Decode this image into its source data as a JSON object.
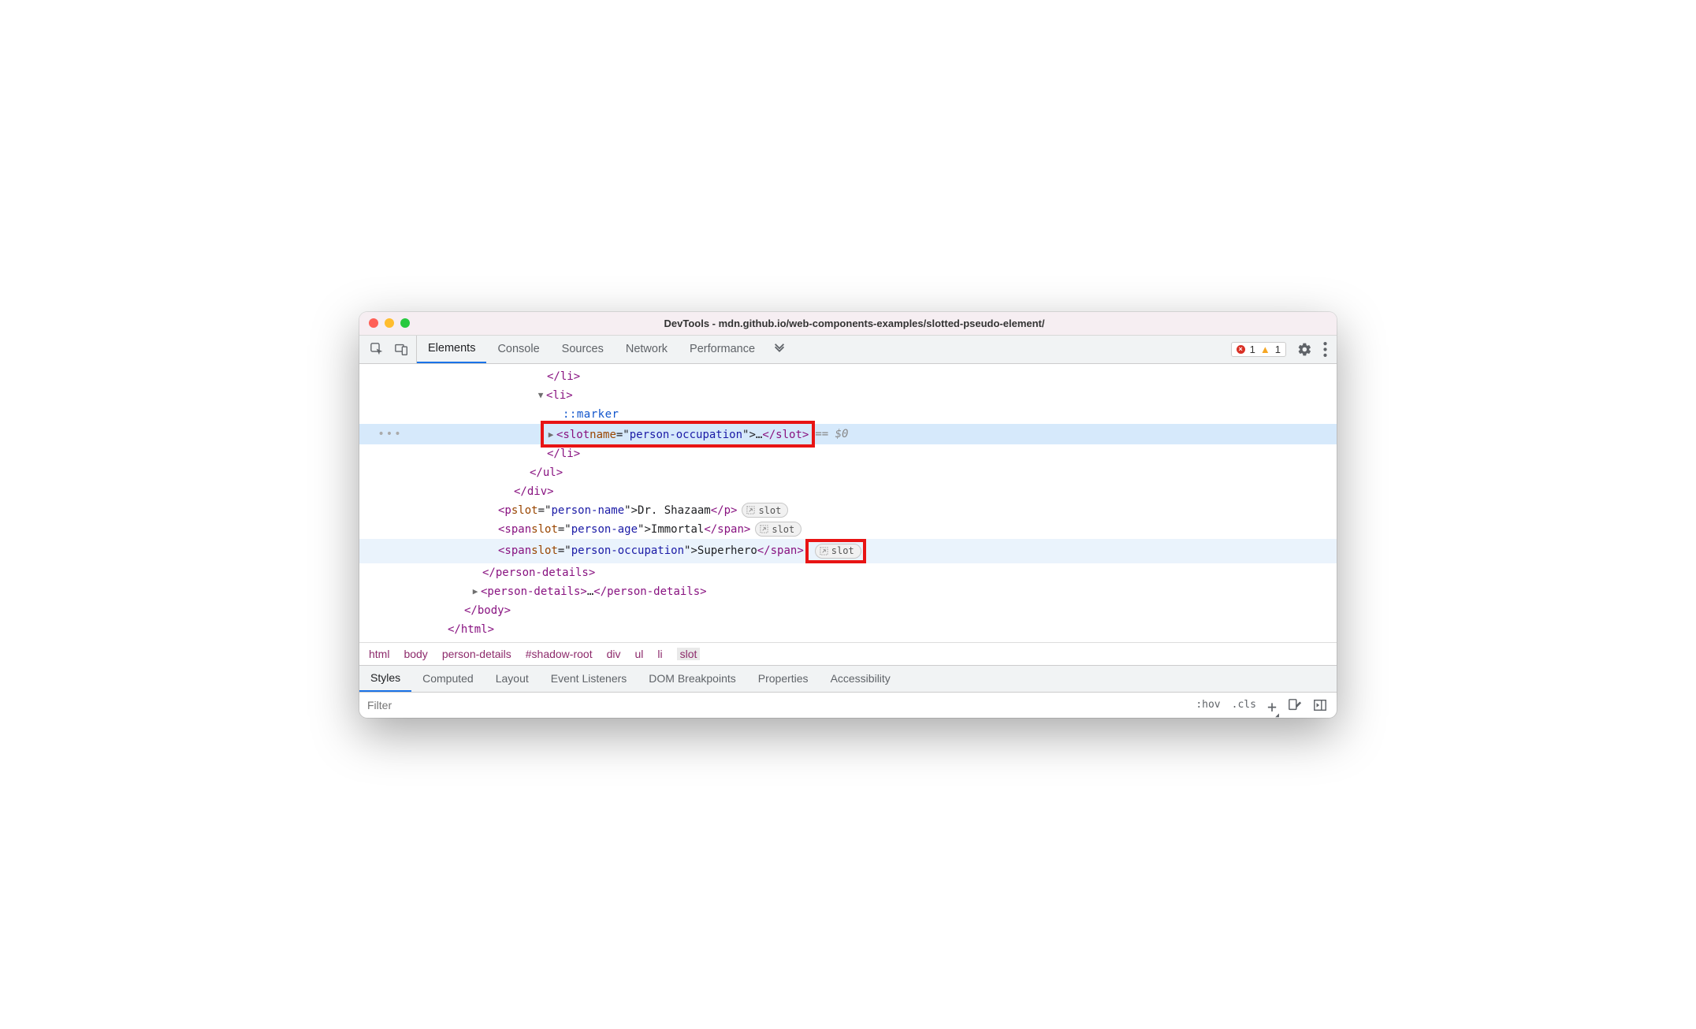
{
  "title": "DevTools - mdn.github.io/web-components-examples/slotted-pseudo-element/",
  "toolbarTabs": {
    "t0": "Elements",
    "t1": "Console",
    "t2": "Sources",
    "t3": "Network",
    "t4": "Performance"
  },
  "issues": {
    "errors": "1",
    "warnings": "1"
  },
  "tree": {
    "liClose": "</li>",
    "liOpen": "<li>",
    "marker": "::marker",
    "slotOpen1": "<slot",
    "slotAttrName": " name",
    "slotAttrEq": "=\"",
    "slotAttrVal": "person-occupation",
    "slotAttrEnd": "\">",
    "ellipsis": "…",
    "slotClose": "</slot>",
    "dollar0": " == $0",
    "ulClose": "</ul>",
    "divClose": "</div>",
    "pOpen": "<p",
    "slotAttr": " slot",
    "eq": "=\"",
    "pName": "person-name",
    "pNameEnd": "\">",
    "pNameText": "Dr. Shazaam",
    "pClose": "</p>",
    "spanOpen": "<span",
    "ageVal": "person-age",
    "ageText": "Immortal",
    "spanClose": "</span>",
    "occVal": "person-occupation",
    "occText": "Superhero",
    "pdClose": "</person-details>",
    "pdOpen": "<person-details>",
    "pdEllip": "…",
    "bodyClose": "</body>",
    "htmlClose": "</html>"
  },
  "badge": "slot",
  "crumbs": {
    "c0": "html",
    "c1": "body",
    "c2": "person-details",
    "c3": "#shadow-root",
    "c4": "div",
    "c5": "ul",
    "c6": "li",
    "c7": "slot"
  },
  "subtabs": {
    "s0": "Styles",
    "s1": "Computed",
    "s2": "Layout",
    "s3": "Event Listeners",
    "s4": "DOM Breakpoints",
    "s5": "Properties",
    "s6": "Accessibility"
  },
  "filter": {
    "placeholder": "Filter",
    "hov": ":hov",
    "cls": ".cls"
  }
}
